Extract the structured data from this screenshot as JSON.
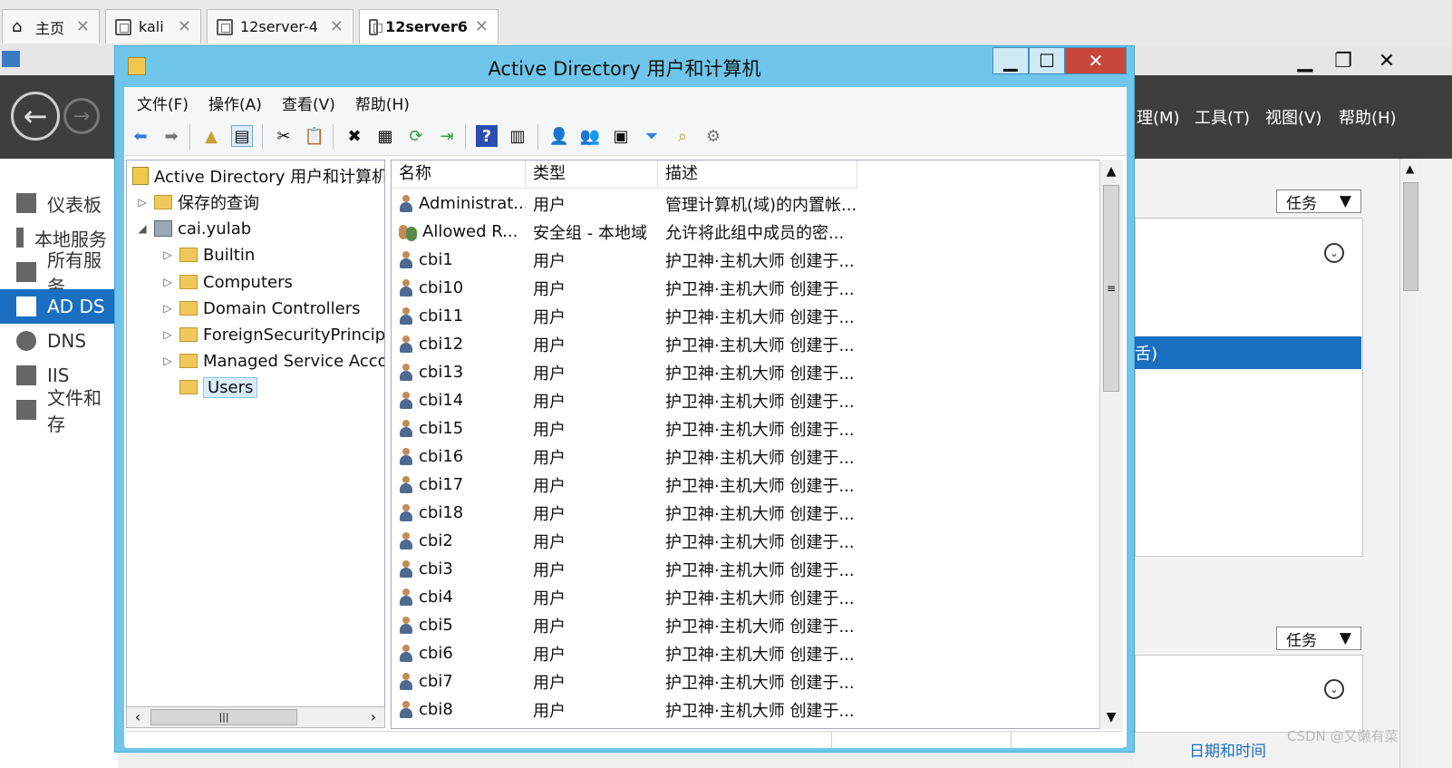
{
  "vm_tabs": [
    {
      "label": "主页",
      "icon": "home-icon"
    },
    {
      "label": "kali",
      "icon": "vm-icon"
    },
    {
      "label": "12server-4",
      "icon": "vm-icon"
    },
    {
      "label": "12server6",
      "icon": "vm-running-icon",
      "active": true
    }
  ],
  "server_manager": {
    "menus": [
      "理(M)",
      "工具(T)",
      "视图(V)",
      "帮助(H)"
    ],
    "nav": [
      {
        "label": "仪表板",
        "icon": "dashboard-icon"
      },
      {
        "label": "本地服务",
        "icon": "local-server-icon"
      },
      {
        "label": "所有服务",
        "icon": "all-servers-icon"
      },
      {
        "label": "AD DS",
        "icon": "adds-icon",
        "selected": true
      },
      {
        "label": "DNS",
        "icon": "dns-icon"
      },
      {
        "label": "IIS",
        "icon": "iis-icon"
      },
      {
        "label": "文件和存",
        "icon": "file-storage-icon"
      }
    ],
    "tasks_label": "任务",
    "selected_row_text": "舌)",
    "date_link": "日期和时间",
    "watermark": "CSDN @又懒有菜"
  },
  "ad_window": {
    "title": "Active Directory 用户和计算机",
    "menu": [
      "文件(F)",
      "操作(A)",
      "查看(V)",
      "帮助(H)"
    ],
    "tree": {
      "root": "Active Directory 用户和计算机",
      "saved_queries": "保存的查询",
      "domain": "cai.yulab",
      "children": [
        "Builtin",
        "Computers",
        "Domain Controllers",
        "ForeignSecurityPrincipals",
        "Managed Service Accounts",
        "Users"
      ]
    },
    "columns": [
      "名称",
      "类型",
      "描述"
    ],
    "rows": [
      {
        "name": "Administrat...",
        "type": "用户",
        "desc": "管理计算机(域)的内置帐...",
        "icon": "user-icon"
      },
      {
        "name": "Allowed R...",
        "type": "安全组 - 本地域",
        "desc": "允许将此组中成员的密...",
        "icon": "group-icon"
      },
      {
        "name": "cbi1",
        "type": "用户",
        "desc": "护卫神·主机大师 创建于...",
        "icon": "user-icon"
      },
      {
        "name": "cbi10",
        "type": "用户",
        "desc": "护卫神·主机大师 创建于...",
        "icon": "user-icon"
      },
      {
        "name": "cbi11",
        "type": "用户",
        "desc": "护卫神·主机大师 创建于...",
        "icon": "user-icon"
      },
      {
        "name": "cbi12",
        "type": "用户",
        "desc": "护卫神·主机大师 创建于...",
        "icon": "user-icon"
      },
      {
        "name": "cbi13",
        "type": "用户",
        "desc": "护卫神·主机大师 创建于...",
        "icon": "user-icon"
      },
      {
        "name": "cbi14",
        "type": "用户",
        "desc": "护卫神·主机大师 创建于...",
        "icon": "user-icon"
      },
      {
        "name": "cbi15",
        "type": "用户",
        "desc": "护卫神·主机大师 创建于...",
        "icon": "user-icon"
      },
      {
        "name": "cbi16",
        "type": "用户",
        "desc": "护卫神·主机大师 创建于...",
        "icon": "user-icon"
      },
      {
        "name": "cbi17",
        "type": "用户",
        "desc": "护卫神·主机大师 创建于...",
        "icon": "user-icon"
      },
      {
        "name": "cbi18",
        "type": "用户",
        "desc": "护卫神·主机大师 创建于...",
        "icon": "user-icon"
      },
      {
        "name": "cbi2",
        "type": "用户",
        "desc": "护卫神·主机大师 创建于...",
        "icon": "user-icon"
      },
      {
        "name": "cbi3",
        "type": "用户",
        "desc": "护卫神·主机大师 创建于...",
        "icon": "user-icon"
      },
      {
        "name": "cbi4",
        "type": "用户",
        "desc": "护卫神·主机大师 创建于...",
        "icon": "user-icon"
      },
      {
        "name": "cbi5",
        "type": "用户",
        "desc": "护卫神·主机大师 创建于...",
        "icon": "user-icon"
      },
      {
        "name": "cbi6",
        "type": "用户",
        "desc": "护卫神·主机大师 创建于...",
        "icon": "user-icon"
      },
      {
        "name": "cbi7",
        "type": "用户",
        "desc": "护卫神·主机大师 创建于...",
        "icon": "user-icon"
      },
      {
        "name": "cbi8",
        "type": "用户",
        "desc": "护卫神·主机大师 创建于...",
        "icon": "user-icon"
      }
    ],
    "colors": {
      "frame": "#6fc6ea",
      "close": "#c7473a",
      "selection": "#d9ecfb"
    }
  }
}
